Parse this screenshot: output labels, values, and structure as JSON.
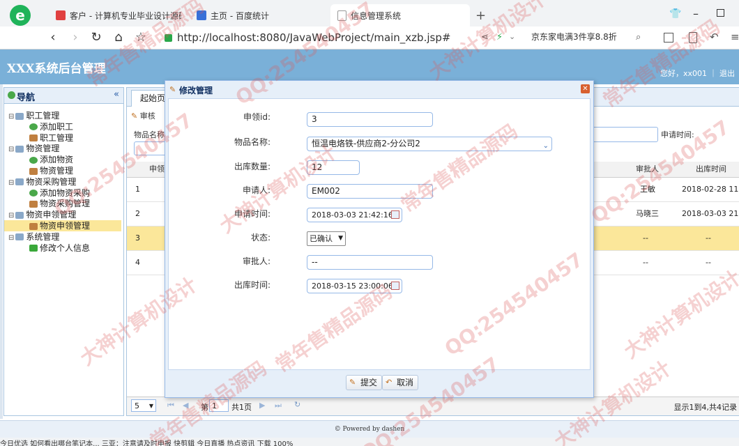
{
  "browser": {
    "tabs": [
      {
        "label": "客户 - 计算机专业毕业设计源码",
        "color": "#e04040"
      },
      {
        "label": "主页 - 百度统计",
        "color": "#3870d8"
      },
      {
        "label": "信息管理系统",
        "color": "#cccccc"
      }
    ],
    "new_tab": "+",
    "url": "http://localhost:8080/JavaWebProject/main_xzb.jsp#",
    "promo": "京东家电满3件享8.8折"
  },
  "app": {
    "title": "XXX系统后台管理",
    "welcome": "您好，xx001 ｜ 退出"
  },
  "nav": {
    "title": "导航",
    "collapse": "«",
    "items": [
      {
        "label": "职工管理",
        "level": 0,
        "type": "folder"
      },
      {
        "label": "添加职工",
        "level": 1,
        "type": "add"
      },
      {
        "label": "职工管理",
        "level": 1,
        "type": "user"
      },
      {
        "label": "物资管理",
        "level": 0,
        "type": "folder"
      },
      {
        "label": "添加物资",
        "level": 1,
        "type": "add"
      },
      {
        "label": "物资管理",
        "level": 1,
        "type": "user"
      },
      {
        "label": "物资采购管理",
        "level": 0,
        "type": "folder"
      },
      {
        "label": "添加物资采购",
        "level": 1,
        "type": "add"
      },
      {
        "label": "物资采购管理",
        "level": 1,
        "type": "user"
      },
      {
        "label": "物资申领管理",
        "level": 0,
        "type": "folder"
      },
      {
        "label": "物资申领管理",
        "level": 1,
        "type": "user",
        "selected": true
      },
      {
        "label": "系统管理",
        "level": 0,
        "type": "folder"
      },
      {
        "label": "修改个人信息",
        "level": 1,
        "type": "edit"
      }
    ]
  },
  "main": {
    "tab": "起始页",
    "toolbar": {
      "audit": "审核"
    },
    "search": {
      "item_name_label": "物品名称:",
      "apply_time_label": "申请时间:"
    },
    "grid": {
      "headers": {
        "applicant": "申领",
        "approver": "审批人",
        "out_time": "出库时间"
      },
      "rows": [
        {
          "num": "1",
          "approver": "王敏",
          "out_time": "2018-02-28 11"
        },
        {
          "num": "2",
          "approver": "马晓三",
          "out_time": "2018-03-03 21"
        },
        {
          "num": "3",
          "approver": "--",
          "out_time": "--"
        },
        {
          "num": "4",
          "approver": "--",
          "out_time": "--"
        }
      ]
    },
    "pager": {
      "page_size": "5",
      "page_prefix": "第",
      "page_value": "1",
      "page_suffix": "共1页",
      "summary": "显示1到4,共4记录"
    }
  },
  "footer": "© Powered by dashen",
  "statusbar": "今日优选    如何看出哪台笔记本...    三亚：注意请及时申报    快剪辑    今日直播    热点资讯    下载    100%",
  "modal": {
    "title": "修改管理",
    "fields": {
      "id": {
        "label": "申领id:",
        "value": "3"
      },
      "item_name": {
        "label": "物品名称:",
        "value": "恒温电烙铁-供应商2-分公司2"
      },
      "quantity": {
        "label": "出库数量:",
        "value": "12"
      },
      "applicant": {
        "label": "申请人:",
        "value": "EM002"
      },
      "apply_time": {
        "label": "申请时间:",
        "value": "2018-03-03 21:42:16"
      },
      "status": {
        "label": "状态:",
        "value": "已确认"
      },
      "approver": {
        "label": "审批人:",
        "value": "--"
      },
      "out_time": {
        "label": "出库时间:",
        "value": "2018-03-15 23:00:06"
      }
    },
    "buttons": {
      "submit": "提交",
      "cancel": "取消"
    }
  },
  "watermarks": [
    "常年售精品源码",
    "QQ:254540457",
    "大神计算机设计"
  ],
  "colors": {
    "header": "#7ab0d8",
    "selected_row": "#fbe79a",
    "modal_border": "#95b8e7"
  }
}
